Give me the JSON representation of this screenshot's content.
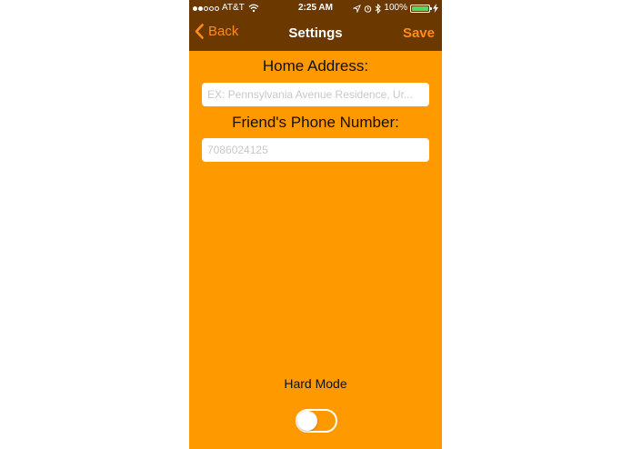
{
  "status_bar": {
    "carrier": "AT&T",
    "time": "2:25 AM",
    "battery_percent": "100%",
    "battery_level": 1.0,
    "signal_bars_filled": 2,
    "signal_bars_total": 5
  },
  "nav": {
    "back_label": "Back",
    "title": "Settings",
    "save_label": "Save"
  },
  "form": {
    "home_address_label": "Home Address:",
    "home_address_placeholder": "EX: Pennsylvania Avenue Residence, Ur...",
    "phone_label": "Friend's Phone Number:",
    "phone_placeholder": "7086024125"
  },
  "hard_mode": {
    "label": "Hard Mode",
    "enabled": false
  },
  "colors": {
    "background": "#FF9900",
    "bar": "#6B3800",
    "accent": "#FF8C1A"
  }
}
